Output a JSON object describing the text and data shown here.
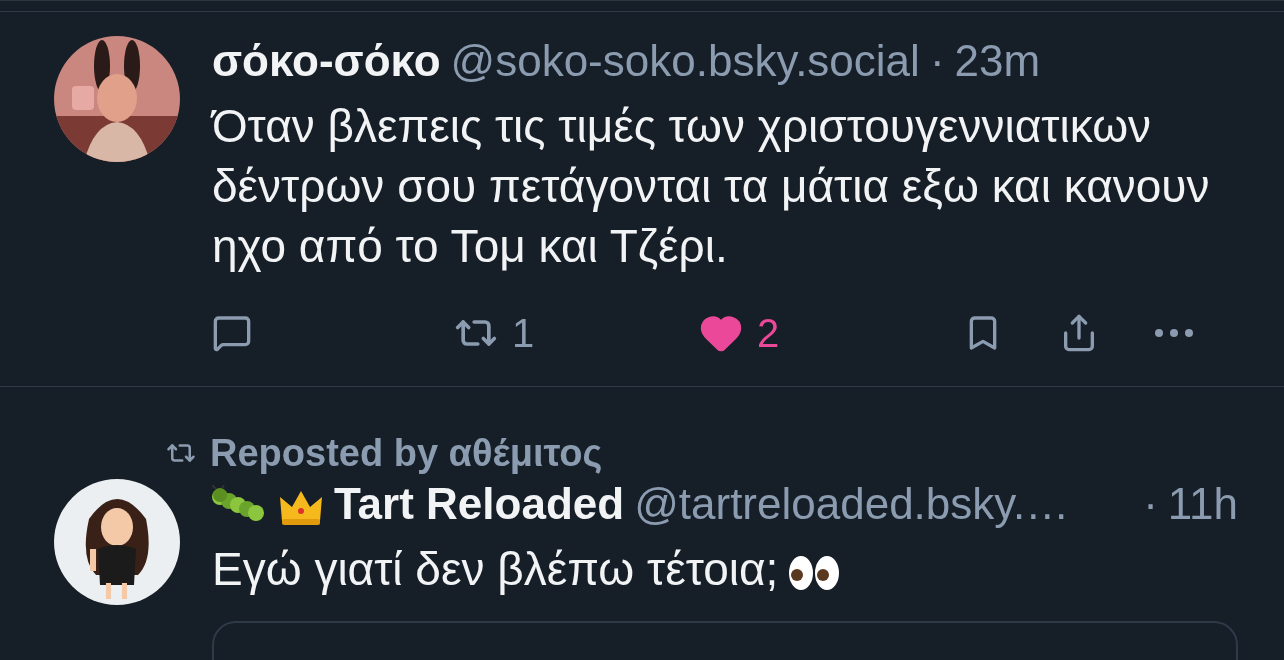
{
  "posts": [
    {
      "avatar": {
        "kind": "picture"
      },
      "name": "σόκο-σόκο",
      "handle": "@soko-soko.bsky.social",
      "separator": "·",
      "time": "23m",
      "text": "Όταν βλεπεις τις τιμές των χριστουγεννιατικων δέντρων σου πετάγονται τα μάτια εξω και κανουν ηχο από το Τομ και Τζέρι.",
      "actions": {
        "repost_count": "1",
        "like_count": "2",
        "liked": true
      }
    },
    {
      "reposted_by": "Reposted by αθέμιτος",
      "avatar": {
        "kind": "picture"
      },
      "badges": [
        {
          "kind": "caterpillar"
        },
        {
          "kind": "crown"
        }
      ],
      "name": "Tart Reloaded",
      "handle": "@tartreloaded.bsky.…",
      "separator": "·",
      "time": "11h",
      "text": "Εγώ γιατί δεν βλέπω τέτοια;",
      "text_emojis": [
        {
          "kind": "eyes"
        }
      ],
      "quote": true
    }
  ]
}
